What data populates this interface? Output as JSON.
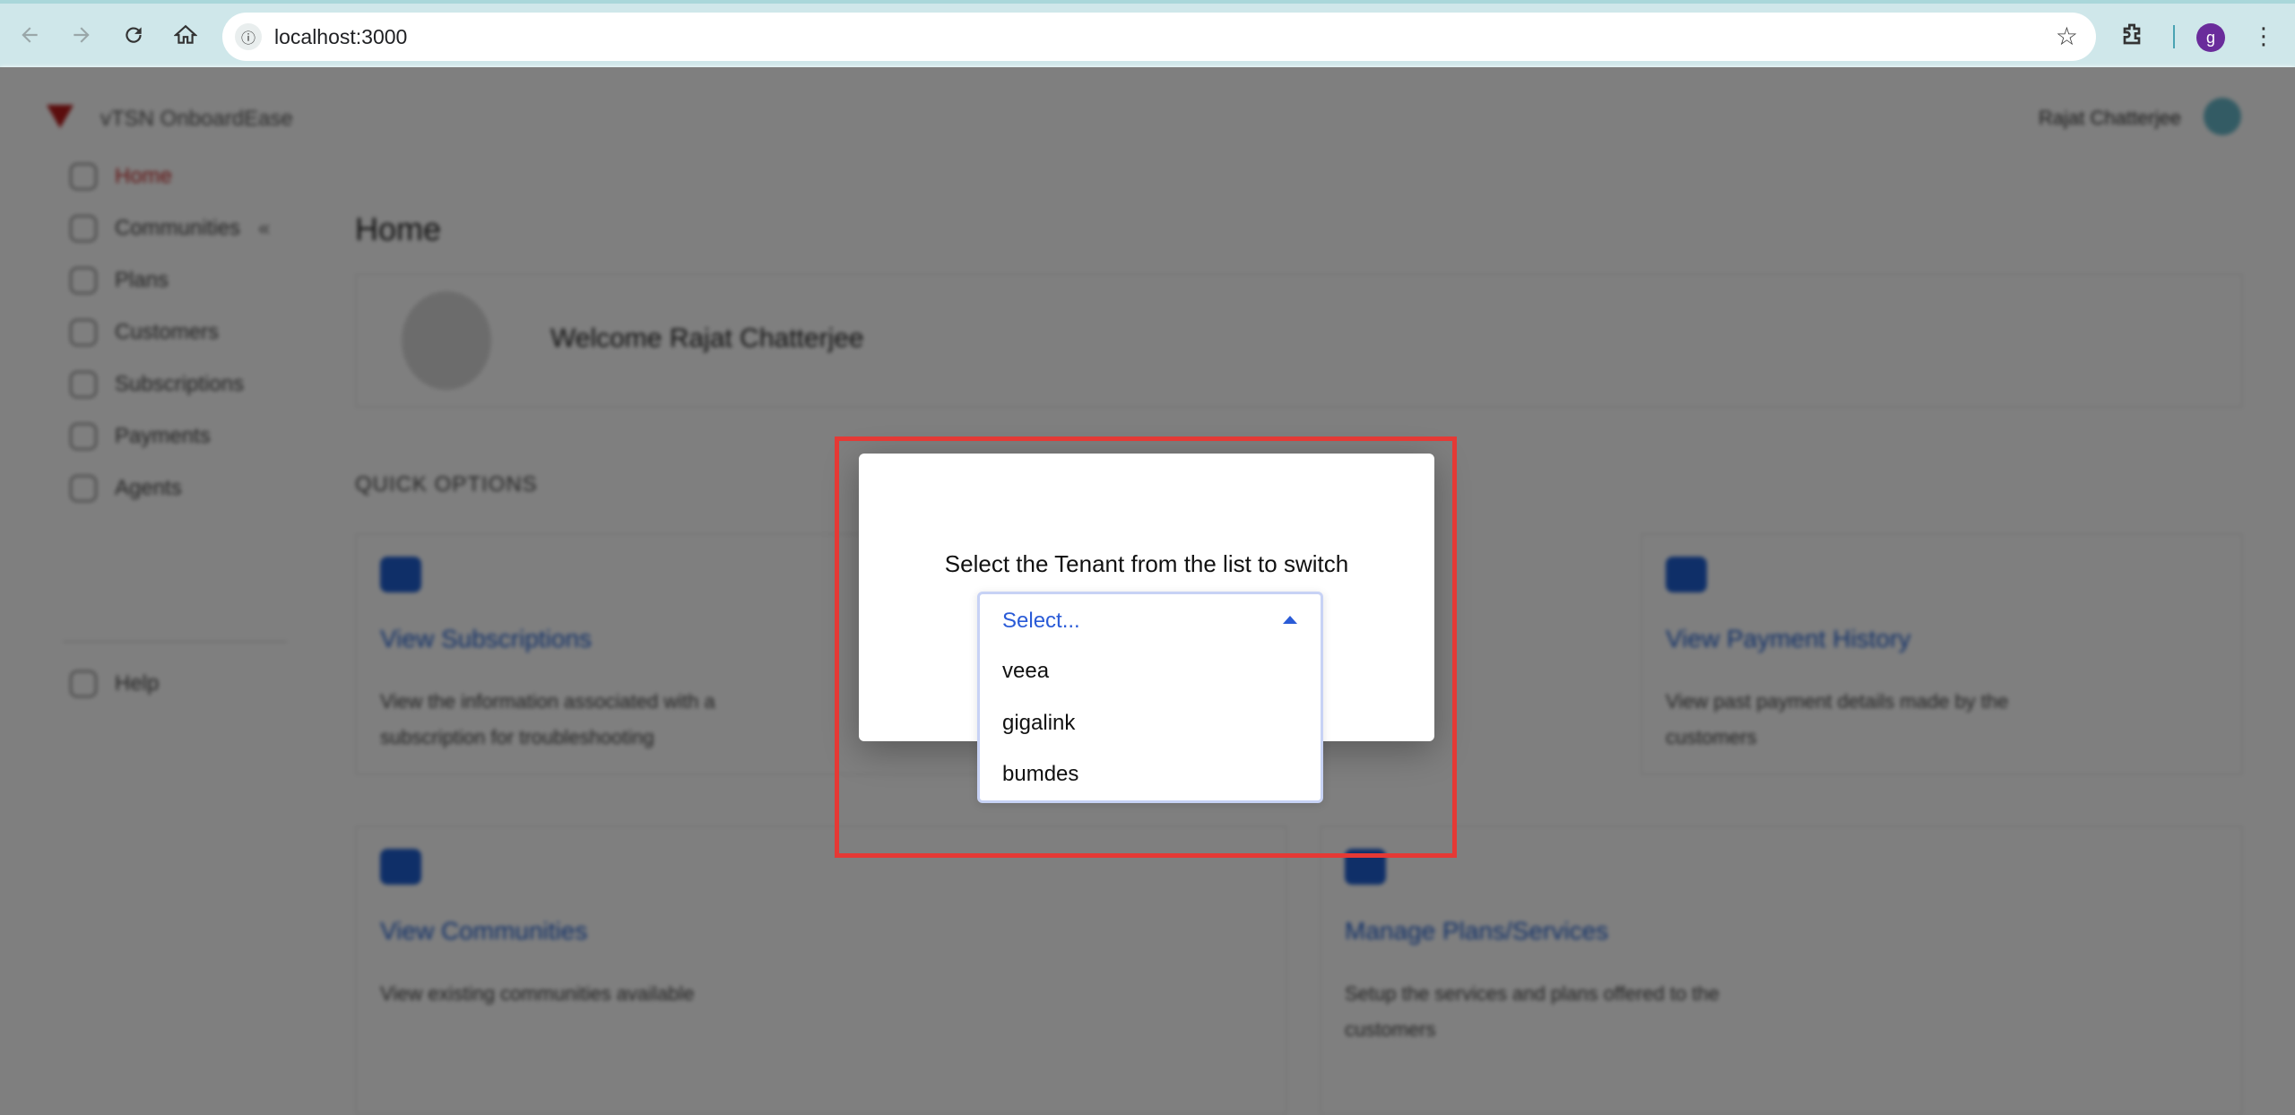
{
  "browser": {
    "url": "localhost:3000",
    "profile_initial": "g"
  },
  "app": {
    "name": "vTSN OnboardEase",
    "user_name": "Rajat Chatterjee",
    "page_title": "Home",
    "welcome": "Welcome Rajat Chatterjee",
    "quick_options_title": "QUICK OPTIONS",
    "sidebar": {
      "items": [
        {
          "label": "Home"
        },
        {
          "label": "Communities"
        },
        {
          "label": "Plans"
        },
        {
          "label": "Customers"
        },
        {
          "label": "Subscriptions"
        },
        {
          "label": "Payments"
        },
        {
          "label": "Agents"
        },
        {
          "label": "Help"
        }
      ]
    },
    "cards": [
      {
        "link": "View Subscriptions",
        "desc": "View the information associated with a subscription for troubleshooting"
      },
      {
        "link": "View Payment History",
        "desc": "View past payment details made by the customers"
      },
      {
        "link": "View Communities",
        "desc": "View existing communities available"
      },
      {
        "link": "Manage Plans/Services",
        "desc": "Setup the services and plans offered to the customers"
      }
    ]
  },
  "modal": {
    "message": "Select the Tenant from the list to switch",
    "select_placeholder": "Select...",
    "options": [
      "veea",
      "gigalink",
      "bumdes"
    ]
  },
  "colors": {
    "accent": "#2a5bd7",
    "highlight": "#e53935",
    "active_nav": "#c62828"
  }
}
